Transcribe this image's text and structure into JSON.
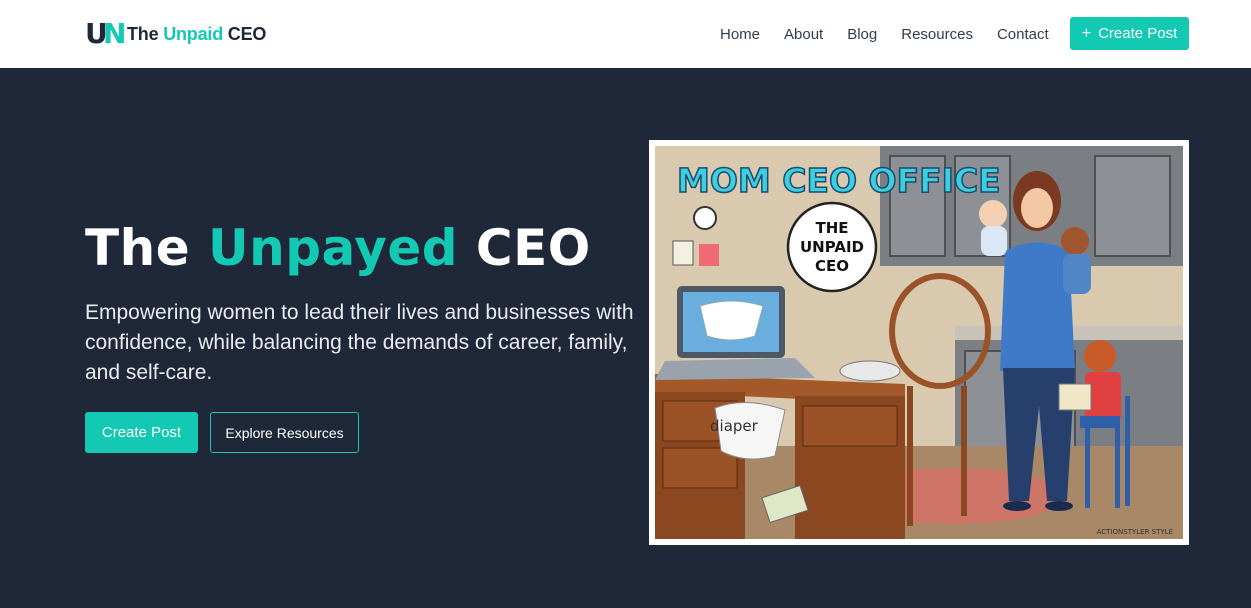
{
  "brand": {
    "logo_letters": "UN",
    "name_part1": "The ",
    "name_accent": "Unpaid",
    "name_part2": " CEO"
  },
  "nav": {
    "items": [
      {
        "label": "Home"
      },
      {
        "label": "About"
      },
      {
        "label": "Blog"
      },
      {
        "label": "Resources"
      },
      {
        "label": "Contact"
      }
    ],
    "cta_icon": "plus-icon",
    "cta_label": "Create Post"
  },
  "hero": {
    "title_part1": "The ",
    "title_accent": "Unpayed",
    "title_part2": " CEO",
    "subtitle": "Empowering women to lead their lives and businesses with confidence, while balancing the demands of career, family, and self-care.",
    "primary_button": "Create Post",
    "secondary_button": "Explore Resources"
  },
  "illustration": {
    "sign_text": "MOM CEO OFFICE",
    "bubble_line1": "THE",
    "bubble_line2": "UNPAID",
    "bubble_line3": "CEO",
    "diaper_label": "diaper",
    "signature": "ACTIONSTYLER STYLE"
  },
  "colors": {
    "accent": "#14c9b3",
    "hero_bg": "#1e2838",
    "header_bg": "#ffffff"
  }
}
